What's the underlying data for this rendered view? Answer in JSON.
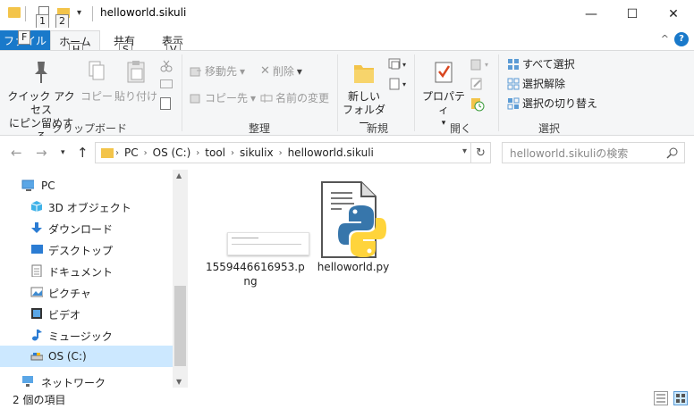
{
  "window": {
    "title": "helloworld.sikuli",
    "minimize": "—",
    "maximize": "☐",
    "close": "✕"
  },
  "keytips": {
    "qa1": "1",
    "qa2": "2",
    "file": "F",
    "home": "H",
    "share": "S",
    "view": "V"
  },
  "tabs": {
    "file": "ファイル",
    "home": "ホーム",
    "share": "共有",
    "view": "表示"
  },
  "ribbon": {
    "clipboard": {
      "pin_label_1": "クイック アクセス",
      "pin_label_2": "にピン留めする",
      "copy": "コピー",
      "paste": "貼り付け",
      "group": "クリップボード"
    },
    "organize": {
      "move_to": "移動先",
      "copy_to": "コピー先",
      "delete": "削除",
      "rename": "名前の変更",
      "group": "整理"
    },
    "new": {
      "new_folder_1": "新しい",
      "new_folder_2": "フォルダー",
      "group": "新規"
    },
    "open": {
      "properties": "プロパティ",
      "group": "開く"
    },
    "select": {
      "select_all": "すべて選択",
      "select_none": "選択解除",
      "invert": "選択の切り替え",
      "group": "選択"
    }
  },
  "address": {
    "crumbs": [
      "PC",
      "OS (C:)",
      "tool",
      "sikulix",
      "helloworld.sikuli"
    ],
    "search_placeholder": "helloworld.sikuliの検索"
  },
  "navpane": {
    "items": [
      {
        "label": "PC",
        "icon": "pc-icon"
      },
      {
        "label": "3D オブジェクト",
        "icon": "3d-objects-icon"
      },
      {
        "label": "ダウンロード",
        "icon": "download-icon"
      },
      {
        "label": "デスクトップ",
        "icon": "desktop-icon"
      },
      {
        "label": "ドキュメント",
        "icon": "documents-icon"
      },
      {
        "label": "ピクチャ",
        "icon": "pictures-icon"
      },
      {
        "label": "ビデオ",
        "icon": "videos-icon"
      },
      {
        "label": "ミュージック",
        "icon": "music-icon"
      },
      {
        "label": "OS (C:)",
        "icon": "drive-icon"
      },
      {
        "label": "ネットワーク",
        "icon": "network-icon"
      }
    ]
  },
  "files": [
    {
      "name_1": "1559446616953.p",
      "name_2": "ng",
      "type": "image-thumbnail"
    },
    {
      "name_1": "helloworld.py",
      "type": "python-file-icon"
    }
  ],
  "status": {
    "count": "2 個の項目"
  },
  "colors": {
    "accent": "#1979ca",
    "selection": "#cce8ff",
    "folder": "#f3c44a",
    "python_blue": "#3776ab",
    "python_yellow": "#ffd43b"
  }
}
